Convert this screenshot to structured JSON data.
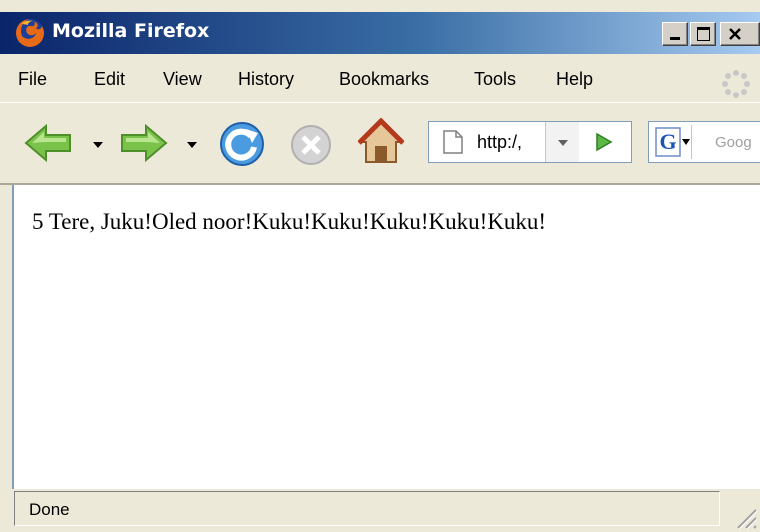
{
  "window": {
    "title": "Mozilla Firefox"
  },
  "menubar": {
    "items": [
      {
        "label": "File"
      },
      {
        "label": "Edit"
      },
      {
        "label": "View"
      },
      {
        "label": "History"
      },
      {
        "label": "Bookmarks"
      },
      {
        "label": "Tools"
      },
      {
        "label": "Help"
      }
    ]
  },
  "navbar": {
    "url": "http:/,",
    "search_placeholder": "Goog",
    "icons": [
      "back-icon",
      "forward-icon",
      "reload-icon",
      "stop-icon",
      "home-icon",
      "page-icon",
      "go-icon",
      "google-icon"
    ]
  },
  "content": {
    "text": "5 Tere, Juku!Oled noor!Kuku!Kuku!Kuku!Kuku!Kuku!"
  },
  "statusbar": {
    "text": "Done"
  },
  "colors": {
    "titlebar_start": "#0A246A",
    "titlebar_end": "#A6CAF0",
    "chrome": "#ECE9D8",
    "nav_green": "#7BC24A"
  }
}
